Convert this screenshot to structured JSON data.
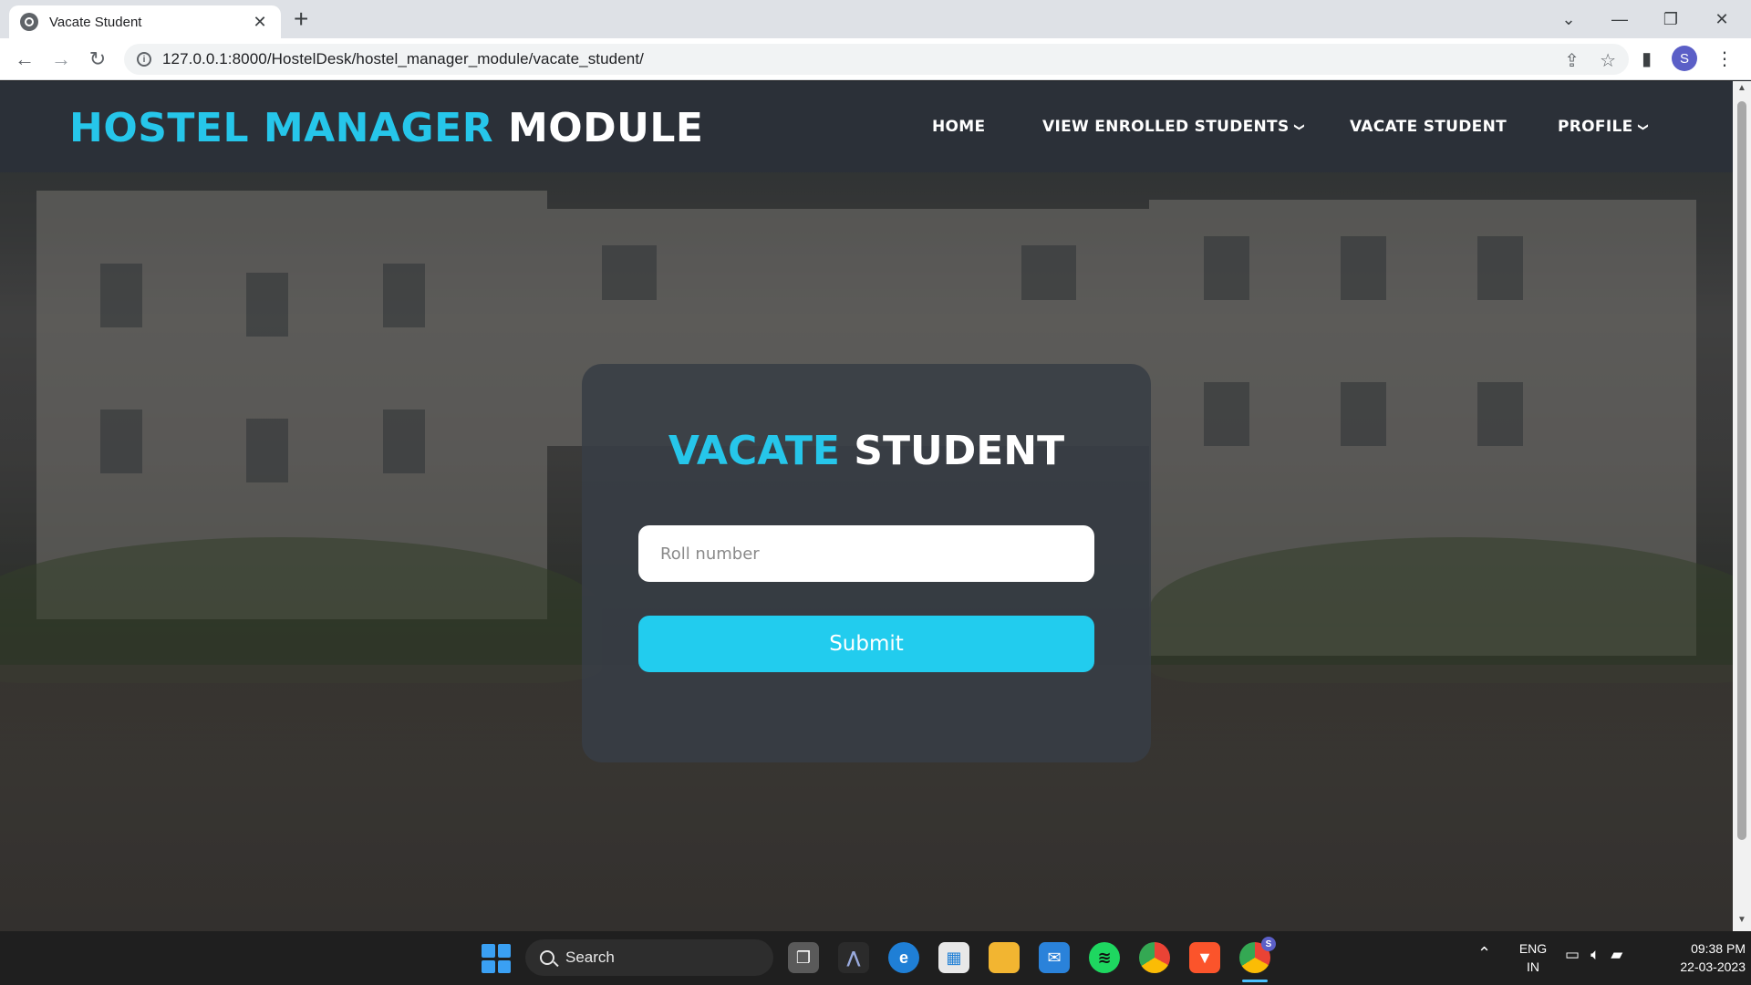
{
  "browser": {
    "tab_title": "Vacate Student",
    "tab_close": "✕",
    "new_tab": "+",
    "url": "127.0.0.1:8000/HostelDesk/hostel_manager_module/vacate_student/",
    "profile_initial": "S"
  },
  "header": {
    "logo_part1": "HOSTEL MANAGER",
    "logo_part2": "MODULE",
    "nav": [
      {
        "label": "HOME"
      },
      {
        "label": "VIEW ENROLLED STUDENTS"
      },
      {
        "label": "VACATE STUDENT"
      },
      {
        "label": "PROFILE"
      }
    ]
  },
  "form": {
    "title_part1": "VACATE",
    "title_part2": "STUDENT",
    "roll_placeholder": "Roll number",
    "roll_value": "",
    "submit_label": "Submit"
  },
  "taskbar": {
    "search_label": "Search",
    "lang_line1": "ENG",
    "lang_line2": "IN",
    "time": "09:38 PM",
    "date": "22-03-2023",
    "chrome_badge": "S"
  },
  "colors": {
    "accent": "#26c6ea",
    "header_bg": "#2b3038",
    "card_bg": "#383e46",
    "button": "#22ccee"
  }
}
